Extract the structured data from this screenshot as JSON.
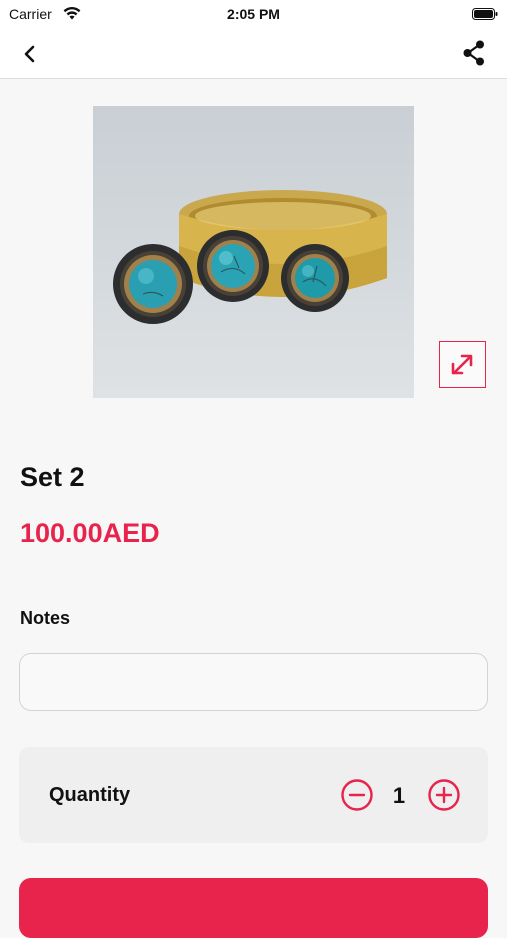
{
  "status_bar": {
    "carrier": "Carrier",
    "time": "2:05 PM"
  },
  "nav": {
    "back_icon": "chevron-left-icon",
    "share_icon": "share-icon"
  },
  "product": {
    "image_subject": "gold cuff bracelet with two turquoise rings",
    "expand_icon": "expand-arrows-icon",
    "title": "Set 2",
    "price": "100.00AED"
  },
  "notes": {
    "label": "Notes",
    "value": "",
    "placeholder": ""
  },
  "quantity": {
    "label": "Quantity",
    "value": "1",
    "minus_icon": "minus-circle-icon",
    "plus_icon": "plus-circle-icon"
  },
  "colors": {
    "accent": "#e8234c",
    "background": "#f7f7f7",
    "card": "#efefef"
  }
}
